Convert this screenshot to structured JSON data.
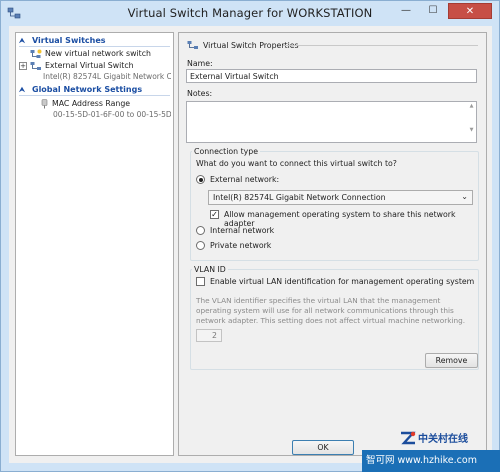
{
  "window": {
    "title": "Virtual Switch Manager for WORKSTATION",
    "min_glyph": "—",
    "max_glyph": "☐",
    "close_glyph": "✕"
  },
  "sidebar": {
    "virtual_switches_header": "Virtual Switches",
    "new_switch_label": "New virtual network switch",
    "external_switch_label": "External Virtual Switch",
    "external_switch_sub": "Intel(R) 82574L Gigabit Network C...",
    "global_settings_header": "Global Network Settings",
    "mac_range_label": "MAC Address Range",
    "mac_range_sub": "00-15-5D-01-6F-00 to 00-15-5D-0..."
  },
  "properties": {
    "header": "Virtual Switch Properties",
    "name_label": "Name:",
    "name_value": "External Virtual Switch",
    "notes_label": "Notes:",
    "notes_value": "",
    "connection": {
      "title": "Connection type",
      "question": "What do you want to connect this virtual switch to?",
      "external_label": "External network:",
      "adapter_selected": "Intel(R) 82574L Gigabit Network Connection",
      "allow_mgmt_label": "Allow management operating system to share this network adapter",
      "allow_mgmt_checked": true,
      "internal_label": "Internal network",
      "private_label": "Private network",
      "selected": "external"
    },
    "vlan": {
      "title": "VLAN ID",
      "enable_label": "Enable virtual LAN identification for management operating system",
      "enable_checked": false,
      "description": "The VLAN identifier specifies the virtual LAN that the management operating system will use for all network communications through this network adapter. This setting does not affect virtual machine networking.",
      "vlan_value": "2"
    },
    "remove_label": "Remove"
  },
  "footer": {
    "ok_label": "OK"
  },
  "watermark": {
    "brand": "中关村在线",
    "site": "智可网 www.hzhike.com"
  },
  "colors": {
    "accent": "#1b4ea3",
    "frame": "#cfe3f6",
    "close": "#c74f46"
  }
}
